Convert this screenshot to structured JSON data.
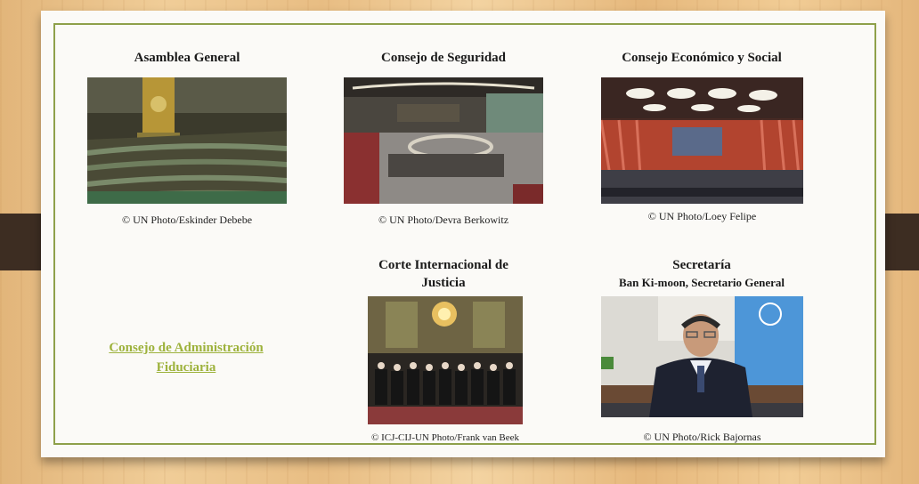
{
  "cards": [
    {
      "title": "Asamblea General",
      "caption": "© UN Photo/Eskinder Debebe",
      "photo": "general-assembly-hall-photo"
    },
    {
      "title": "Consejo de Seguridad",
      "caption": "© UN Photo/Devra Berkowitz",
      "photo": "security-council-chamber-photo"
    },
    {
      "title": "Consejo Económico y Social",
      "caption": "© UN Photo/Loey Felipe",
      "photo": "ecosoc-chamber-photo"
    },
    {
      "title_line1": "Corte Internacional de",
      "title_line2": "Justicia",
      "caption": "© ICJ-CIJ-UN Photo/Frank van Beek",
      "photo": "icj-judges-photo"
    },
    {
      "title": "Secretaría",
      "subtitle": "Ban Ki-moon, Secretario General",
      "caption": "© UN Photo/Rick Bajornas",
      "photo": "ban-ki-moon-photo"
    }
  ],
  "trusteeship_link": {
    "line1": "Consejo de Administración",
    "line2": "Fiduciaria"
  },
  "colors": {
    "frame": "#8ea04a",
    "link": "#9db23c",
    "band": "#3d2d22"
  }
}
